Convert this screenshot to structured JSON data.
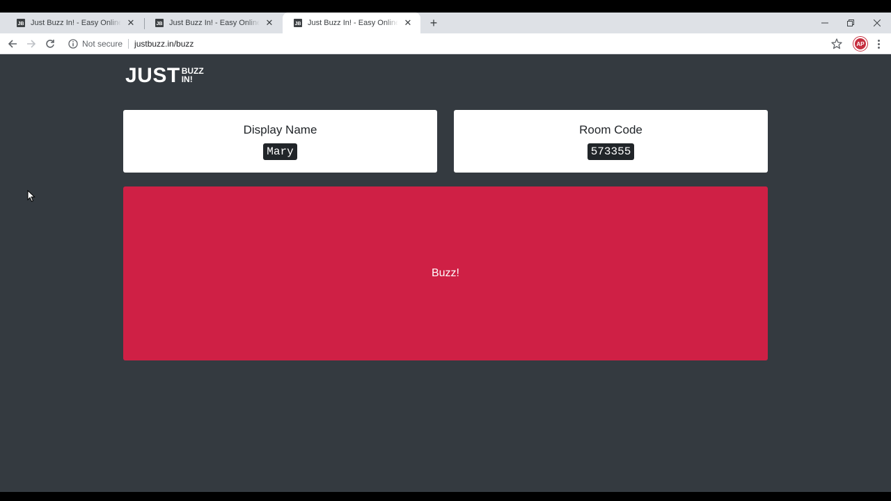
{
  "browser": {
    "tabs": [
      {
        "title": "Just Buzz In! - Easy Online Buzzer",
        "active": false
      },
      {
        "title": "Just Buzz In! - Easy Online Buzzer",
        "active": false
      },
      {
        "title": "Just Buzz In! - Easy Online Buzzer",
        "active": true
      }
    ],
    "new_tab_label": "+",
    "security_label": "Not secure",
    "url": "justbuzz.in/buzz",
    "profile_initials": "AP"
  },
  "logo": {
    "main": "JUST",
    "line1": "BUZZ",
    "line2": "IN!"
  },
  "display_name_card": {
    "label": "Display Name",
    "value": "Mary"
  },
  "room_code_card": {
    "label": "Room Code",
    "value": "573355"
  },
  "buzz_button": {
    "label": "Buzz!",
    "color": "#cf2045"
  },
  "colors": {
    "page_background": "#343a40",
    "card_background": "#ffffff",
    "code_background": "#212529"
  }
}
